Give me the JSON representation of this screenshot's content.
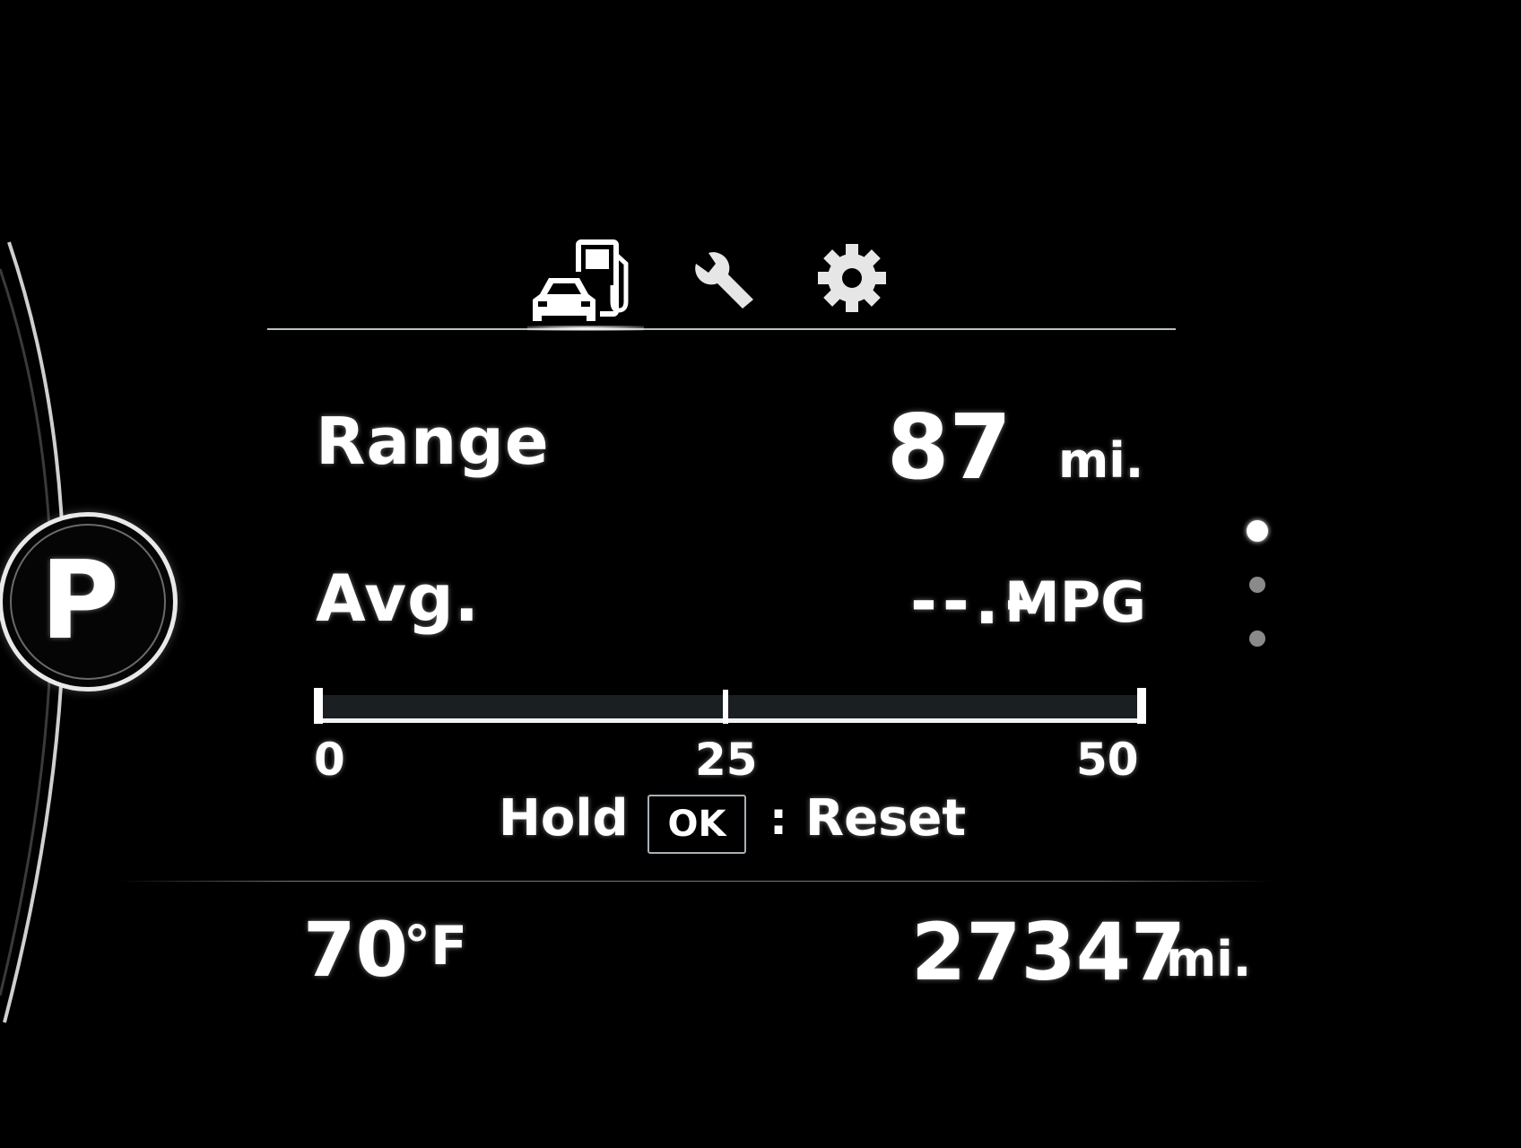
{
  "gear": {
    "current": "P"
  },
  "tabs": [
    {
      "name": "trip-info",
      "icon": "car-fuel-pump-icon",
      "active": true
    },
    {
      "name": "service",
      "icon": "wrench-icon",
      "active": false
    },
    {
      "name": "settings",
      "icon": "gear-icon",
      "active": false
    }
  ],
  "trip": {
    "range_label": "Range",
    "range_value": "87",
    "range_unit": "mi.",
    "avg_label": "Avg.",
    "avg_value": "--.-",
    "avg_unit": "MPG"
  },
  "mpg_bar": {
    "min_label": "0",
    "mid_label": "25",
    "max_label": "50",
    "current_fraction": 0
  },
  "reset_hint": {
    "hold": "Hold",
    "key": "OK",
    "separator": ":",
    "action": "Reset"
  },
  "page_indicator": {
    "pages": 3,
    "current": 1
  },
  "status": {
    "temperature": "70",
    "temperature_unit": "°F",
    "odometer": "27347",
    "odometer_unit": "mi."
  },
  "colors": {
    "background": "#000000",
    "text": "#ffffff",
    "divider": "#b9c2c8",
    "dot_inactive": "#8a8a8a"
  }
}
